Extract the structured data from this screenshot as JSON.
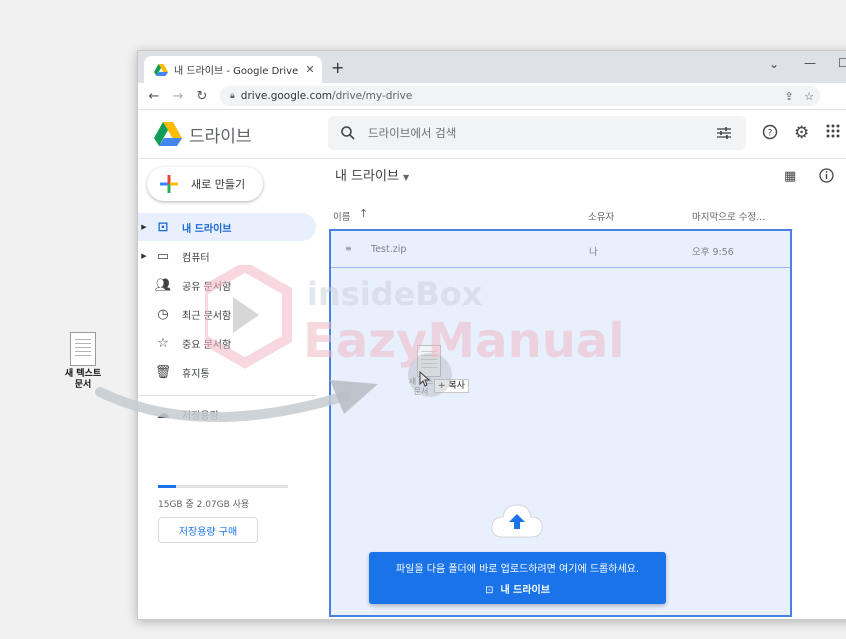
{
  "desktop": {
    "file_label_1": "새 텍스트",
    "file_label_2": "문서"
  },
  "browser": {
    "tab_title": "내 드라이브 - Google Drive",
    "tab_close": "✕",
    "new_tab": "+",
    "url_host": "drive.google.com",
    "url_path": "/drive/my-drive",
    "win_min": "—",
    "win_max": "☐",
    "win_dropdown": "⌄"
  },
  "app": {
    "title": "드라이브",
    "search_placeholder": "드라이브에서 검색"
  },
  "sidebar": {
    "new_label": "새로 만들기",
    "items": [
      {
        "label": "내 드라이브",
        "icon": "drive-icon",
        "active": true
      },
      {
        "label": "컴퓨터",
        "icon": "computer-icon"
      },
      {
        "label": "공유 문서함",
        "icon": "people-icon"
      },
      {
        "label": "최근 문서함",
        "icon": "clock-icon"
      },
      {
        "label": "중요 문서함",
        "icon": "star-icon"
      },
      {
        "label": "휴지통",
        "icon": "trash-icon"
      },
      {
        "label": "저장용량",
        "icon": "cloud-icon"
      }
    ],
    "storage_text": "15GB 중 2.07GB 사용",
    "storage_fraction": 0.138,
    "buy_label": "저장용량 구매"
  },
  "main": {
    "breadcrumb": "내 드라이브",
    "columns": {
      "name": "이름",
      "owner": "소유자",
      "modified": "마지막으로 수정..."
    },
    "files": [
      {
        "name": "Test.zip",
        "owner": "나",
        "modified": "오후 9:56"
      }
    ],
    "drag": {
      "file_name_1": "새 텍스",
      "file_name_2": "문서",
      "copy_tag": "+ 복사"
    },
    "toast": {
      "message": "파일을 다음 폴더에 바로 업로드하려면 여기에 드롭하세요.",
      "destination": "내 드라이브"
    }
  },
  "watermark": {
    "line1": "insideBox",
    "line2": "EazyManual"
  },
  "colors": {
    "accent": "#1a73e8",
    "active_bg": "#e8f0fe",
    "drop_border": "#4a80e0"
  }
}
